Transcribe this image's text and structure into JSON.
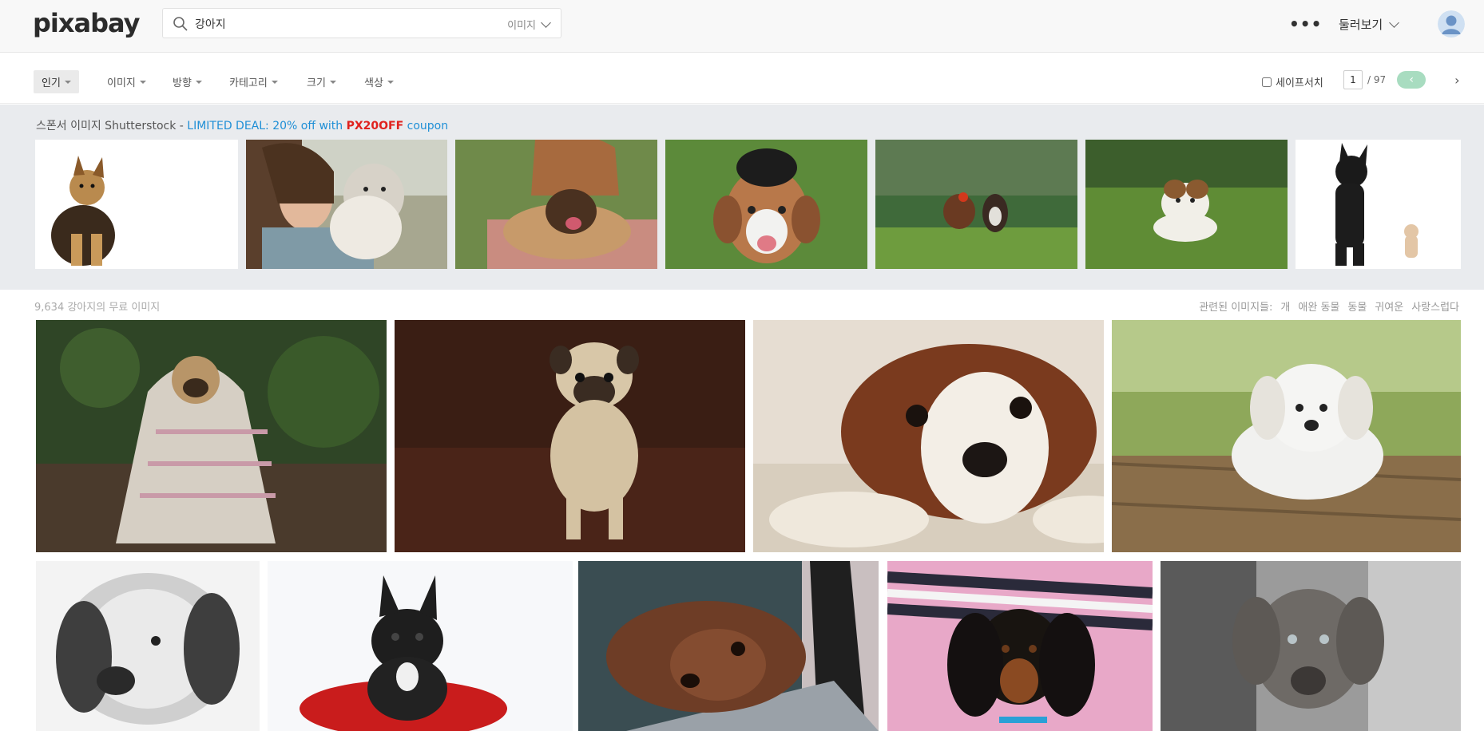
{
  "header": {
    "logo": "pixabay",
    "search_value": "강아지",
    "search_type": "이미지",
    "more": "•••",
    "explore": "둘러보기"
  },
  "filters": [
    {
      "label": "인기",
      "active": true
    },
    {
      "label": "이미지"
    },
    {
      "label": "방향"
    },
    {
      "label": "카테고리"
    },
    {
      "label": "크기"
    },
    {
      "label": "색상"
    }
  ],
  "safesearch": {
    "label": "세이프서치"
  },
  "pager": {
    "current": "1",
    "total": "/ 97",
    "prev": "‹",
    "next": "›"
  },
  "sponsor": {
    "prefix": "스폰서 이미지 Shutterstock - ",
    "deal": "LIMITED DEAL: 20% off with ",
    "code": "PX20OFF",
    "suffix": " coupon"
  },
  "results": {
    "count_text": "9,634 강아지의 무료 이미지",
    "related_label": "관련된 이미지들:",
    "related_tags": [
      "개",
      "애완 동물",
      "동물",
      "귀여운",
      "사랑스럽다"
    ]
  }
}
